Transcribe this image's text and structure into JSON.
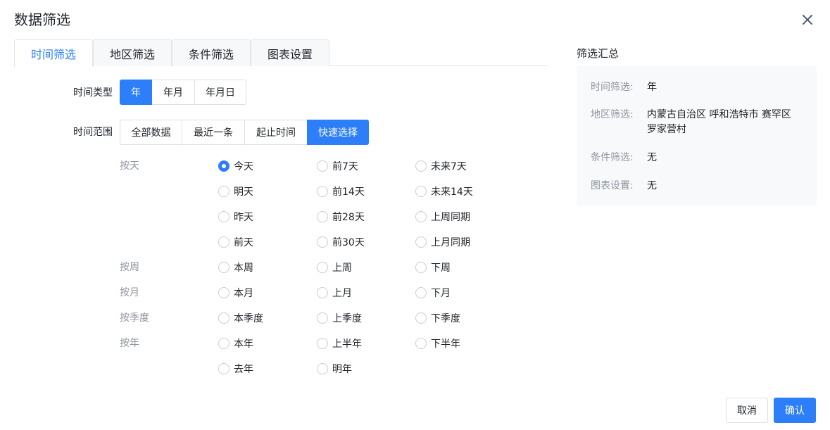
{
  "dialog": {
    "title": "数据筛选"
  },
  "tabs": [
    {
      "label": "时间筛选",
      "active": true
    },
    {
      "label": "地区筛选",
      "active": false
    },
    {
      "label": "条件筛选",
      "active": false
    },
    {
      "label": "图表设置",
      "active": false
    }
  ],
  "time_type": {
    "label": "时间类型",
    "options": [
      "年",
      "年月",
      "年月日"
    ],
    "selected": "年"
  },
  "time_range": {
    "label": "时间范围",
    "options": [
      "全部数据",
      "最近一条",
      "起止时间",
      "快速选择"
    ],
    "selected": "快速选择"
  },
  "quick_select": {
    "groups": [
      {
        "label": "按天",
        "rows": [
          [
            "今天",
            "前7天",
            "未来7天"
          ],
          [
            "明天",
            "前14天",
            "未来14天"
          ],
          [
            "昨天",
            "前28天",
            "上周同期"
          ],
          [
            "前天",
            "前30天",
            "上月同期"
          ]
        ]
      },
      {
        "label": "按周",
        "rows": [
          [
            "本周",
            "上周",
            "下周"
          ]
        ]
      },
      {
        "label": "按月",
        "rows": [
          [
            "本月",
            "上月",
            "下月"
          ]
        ]
      },
      {
        "label": "按季度",
        "rows": [
          [
            "本季度",
            "上季度",
            "下季度"
          ]
        ]
      },
      {
        "label": "按年",
        "rows": [
          [
            "本年",
            "上半年",
            "下半年"
          ],
          [
            "去年",
            "明年"
          ]
        ]
      }
    ],
    "selected": "今天"
  },
  "summary": {
    "title": "筛选汇总",
    "items": [
      {
        "key": "时间筛选:",
        "value": "年"
      },
      {
        "key": "地区筛选:",
        "value": "内蒙古自治区 呼和浩特市 赛罕区 罗家营村"
      },
      {
        "key": "条件筛选:",
        "value": "无"
      },
      {
        "key": "图表设置:",
        "value": "无"
      }
    ]
  },
  "footer": {
    "cancel_label": "取消",
    "confirm_label": "确认"
  },
  "colors": {
    "accent": "#2d7ff9",
    "muted_text": "#8f959e",
    "border": "#dcdfe6",
    "summary_bg": "#f8f9fb"
  }
}
